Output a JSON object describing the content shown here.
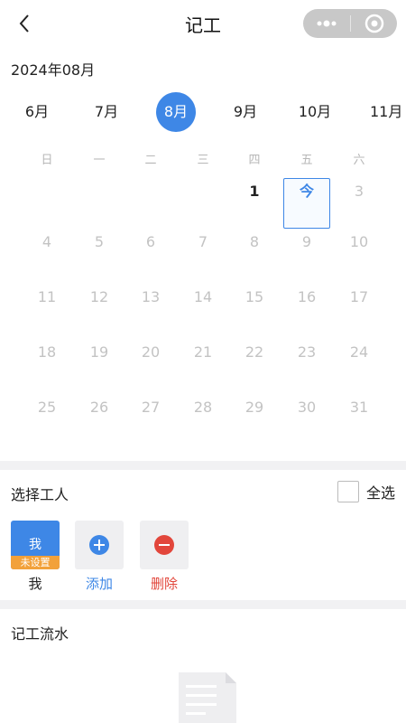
{
  "nav": {
    "title": "记工",
    "back_icon": "chevron-left-icon",
    "more_icon": "more-dots-icon",
    "close_icon": "target-close-icon"
  },
  "calendar": {
    "year_month": "2024年08月",
    "months": [
      "6月",
      "7月",
      "8月",
      "9月",
      "10月",
      "11月"
    ],
    "active_month": "8月",
    "weekdays": [
      "日",
      "一",
      "二",
      "三",
      "四",
      "五",
      "六"
    ],
    "today_label": "今",
    "days": [
      "",
      "",
      "",
      "",
      "1",
      "今",
      "3",
      "4",
      "5",
      "6",
      "7",
      "8",
      "9",
      "10",
      "11",
      "12",
      "13",
      "14",
      "15",
      "16",
      "17",
      "18",
      "19",
      "20",
      "21",
      "22",
      "23",
      "24",
      "25",
      "26",
      "27",
      "28",
      "29",
      "30",
      "31"
    ],
    "accent": "#3e87e6"
  },
  "workers": {
    "title": "选择工人",
    "select_all": "全选",
    "me": {
      "name": "我",
      "tag": "未设置",
      "caption": "我"
    },
    "add_label": "添加",
    "delete_label": "删除"
  },
  "records": {
    "title": "记工流水",
    "empty_icon": "document-icon"
  }
}
